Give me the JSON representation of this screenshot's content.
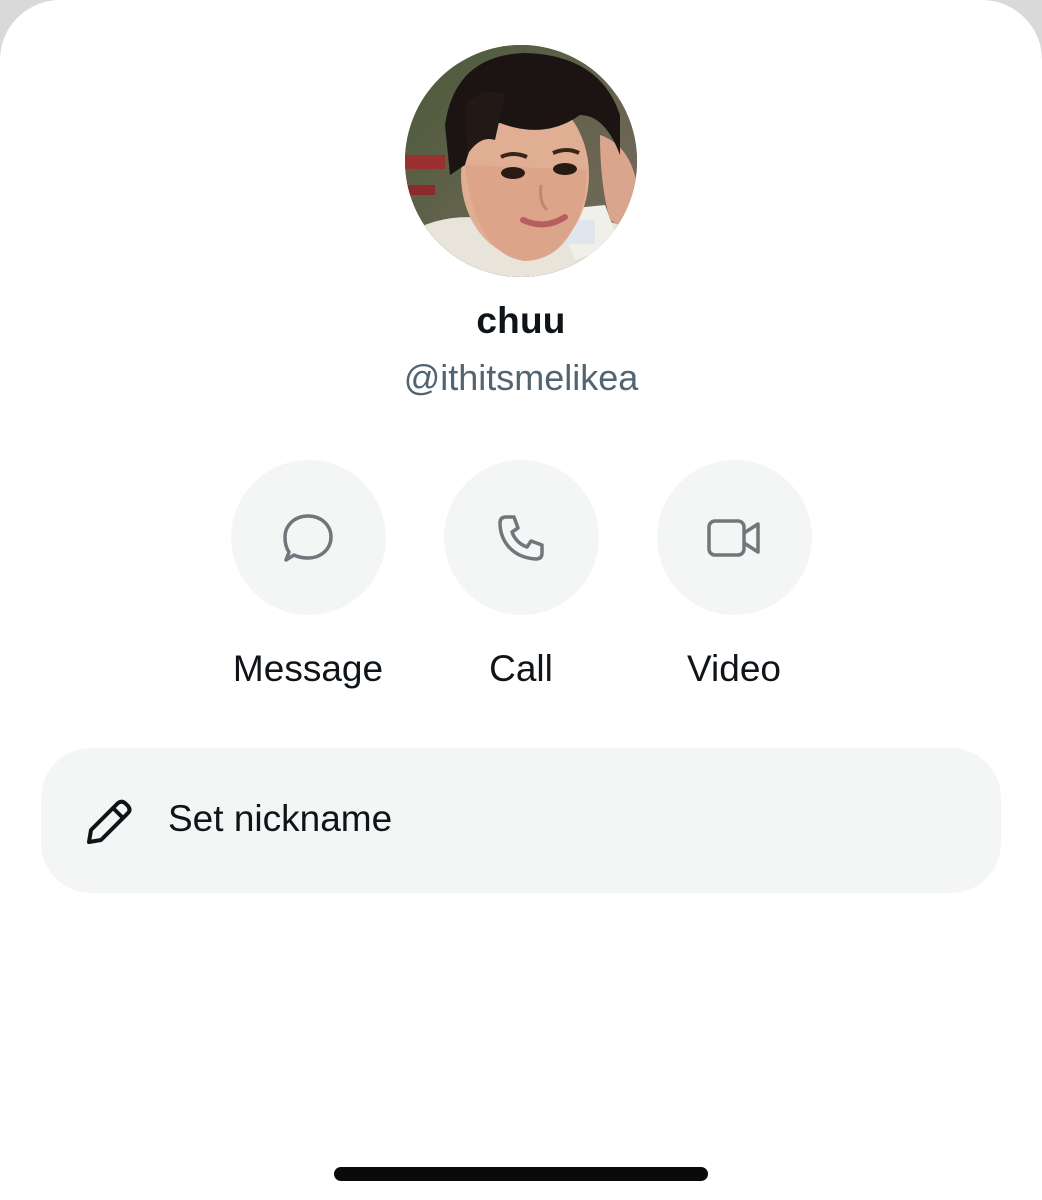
{
  "profile": {
    "display_name": "chuu",
    "handle": "@ithitsmelikea",
    "avatar": "profile-photo"
  },
  "actions": [
    {
      "label": "Message",
      "icon": "chat-bubble-icon"
    },
    {
      "label": "Call",
      "icon": "phone-icon"
    },
    {
      "label": "Video",
      "icon": "video-camera-icon"
    }
  ],
  "nickname": {
    "label": "Set nickname",
    "icon": "pencil-icon"
  },
  "colors": {
    "text_primary": "#0f1419",
    "text_secondary": "#536471",
    "button_bg": "#f4f5f5",
    "icon_gray": "#71767b"
  }
}
